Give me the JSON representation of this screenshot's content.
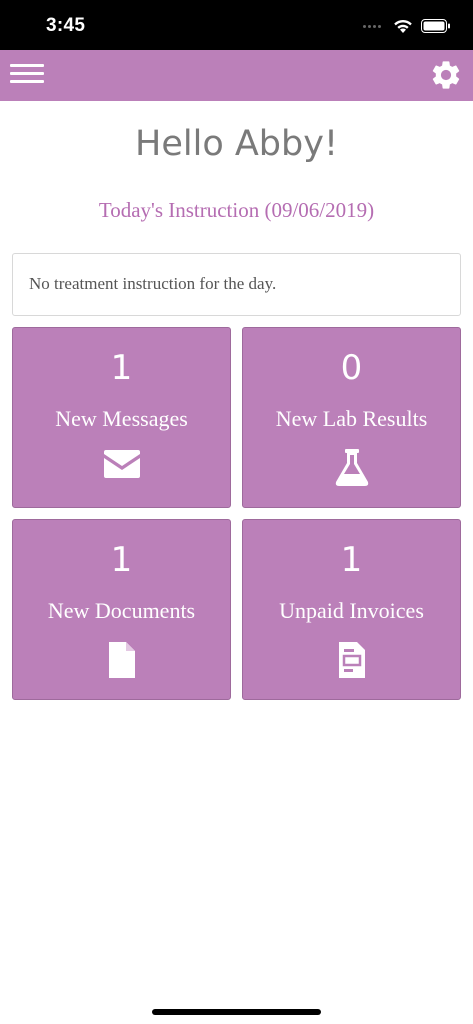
{
  "status_bar": {
    "time": "3:45"
  },
  "header": {
    "menu_icon": "hamburger-menu-icon",
    "settings_icon": "gear-icon",
    "accent_color": "#bb80b9"
  },
  "greeting": "Hello Abby!",
  "instruction": {
    "title": "Today's Instruction (09/06/2019)",
    "message": "No treatment instruction for the day."
  },
  "tiles": [
    {
      "count": "1",
      "label": "New Messages",
      "icon": "envelope-icon"
    },
    {
      "count": "0",
      "label": "New Lab Results",
      "icon": "flask-icon"
    },
    {
      "count": "1",
      "label": "New Documents",
      "icon": "document-icon"
    },
    {
      "count": "1",
      "label": "Unpaid Invoices",
      "icon": "invoice-icon"
    }
  ]
}
